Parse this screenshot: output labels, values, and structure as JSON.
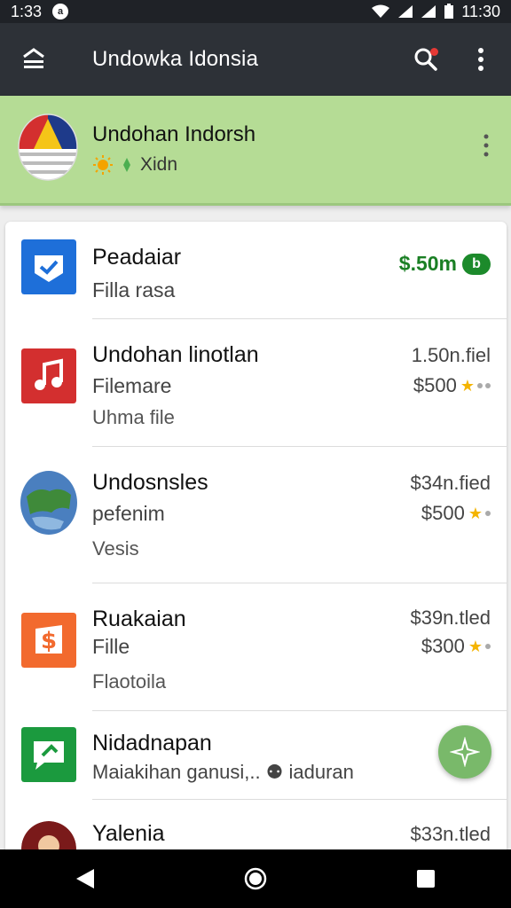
{
  "status_bar": {
    "left_time": "1:33",
    "right_time": "11:30"
  },
  "app_bar": {
    "title": "Undowka Idonsia"
  },
  "account": {
    "name": "Undohan Indorsh",
    "sub_label": "Xidn"
  },
  "items": [
    {
      "title": "Peadaiar",
      "line2": "Filla rasa",
      "price": "$.50m",
      "badge": "b"
    },
    {
      "title": "Undohan linotlan",
      "line2": "Filemare",
      "line3": "Uhma file",
      "meta": "1.50n.fiel",
      "price": "$500"
    },
    {
      "title": "Undosnsles",
      "line2": "pefenim",
      "line3": "Vesis",
      "meta": "$34n.fied",
      "price": "$500"
    },
    {
      "title": "Ruakaian",
      "line2": "Fille",
      "line3": "Flaotoila",
      "meta": "$39n.tled",
      "price": "$300"
    },
    {
      "title": "Nidadnapan",
      "line2": "Maiakihan ganusi,.. ⚉ iaduran"
    },
    {
      "title": "Yalenia",
      "meta": "$33n.tled"
    }
  ],
  "colors": {
    "app_bar": "#2d3137",
    "account_card": "#b5dc95",
    "accent_green": "#1c8a2b",
    "fab": "#79b96a"
  },
  "icons": [
    "menu-icon",
    "search-icon",
    "more-vert-icon",
    "shield-check-icon",
    "music-note-icon",
    "globe-icon",
    "dollar-icon",
    "chat-icon",
    "compass-icon",
    "back-icon",
    "home-icon",
    "recents-icon"
  ]
}
